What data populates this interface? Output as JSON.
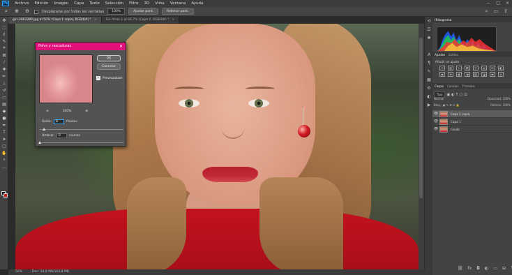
{
  "app": {
    "logo": "Ps",
    "menus": [
      "Archivo",
      "Edición",
      "Imagen",
      "Capa",
      "Texto",
      "Selección",
      "Filtro",
      "3D",
      "Vista",
      "Ventana",
      "Ayuda"
    ],
    "window_controls": [
      "—",
      "□",
      "✕"
    ]
  },
  "options": {
    "scroll_all_label": "Desplazarse por todas las ventanas",
    "zoom_value": "100%",
    "fit_screen_label": "Ajustar pant.",
    "fill_screen_label": "Rellenar pant."
  },
  "tabs": [
    {
      "label": "girl-3983380.jpg al 50% (Capa 1 copia, RGB/8#) *",
      "close": "×"
    },
    {
      "label": "Sin título-1 al 66,7% (Capa 2, RGB/8#) *",
      "close": "×"
    }
  ],
  "statusbar": {
    "zoom": "50%",
    "doc": "Doc: 34,9 MB/104,8 MB"
  },
  "panels": {
    "top_tabs": [
      "Histograma"
    ],
    "adjust_tabs": [
      "Ajustes",
      "Estilos"
    ],
    "adjust_title": "Añadir un ajuste",
    "layers_tabs": [
      "Capas",
      "Canales",
      "Trazados"
    ],
    "kind_label": "Tipo",
    "blend_mode": "Normal",
    "opacity_label": "Opacidad:",
    "opacity_value": "100%",
    "lock_label": "Bloq.:",
    "fill_label": "Relleno:",
    "fill_value": "100%",
    "layers": [
      {
        "name": "Capa 1 copia",
        "selected": true
      },
      {
        "name": "Capa 1",
        "selected": false
      },
      {
        "name": "Fondo",
        "selected": false
      }
    ]
  },
  "dialog": {
    "title": "Polvo y rascaduras",
    "ok_label": "OK",
    "cancel_label": "Cancelar",
    "preview_label": "Previsualizar",
    "preview_checked": true,
    "zoom": "100%",
    "radius_label": "Radio:",
    "radius_value": "8",
    "radius_unit": "Píxeles",
    "threshold_label": "Umbral:",
    "threshold_value": "0",
    "threshold_unit": "niveles"
  },
  "colors": {
    "dialog_title": "#e1107a",
    "accent": "#31a8ff",
    "foreground_swatch": "#111111",
    "background_swatch": "#cc1e24"
  }
}
